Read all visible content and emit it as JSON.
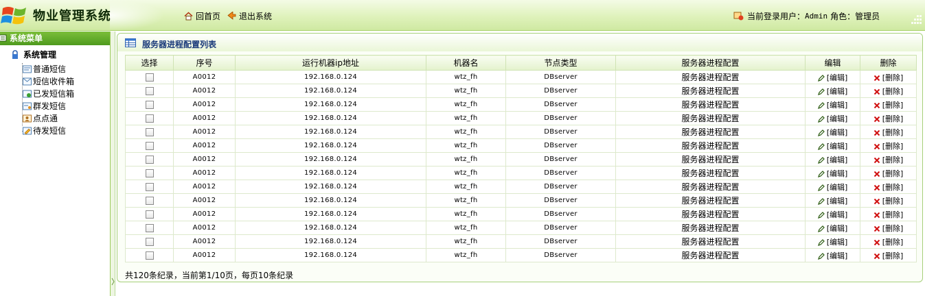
{
  "header": {
    "app_title": "物业管理系统",
    "home_label": "回首页",
    "logout_label": "退出系统",
    "user_prefix": "当前登录用户：",
    "user_name": "Admin",
    "role_prefix": "角色：",
    "role_name": "管理员"
  },
  "sidebar": {
    "title": "系统菜单",
    "group_title": "系统管理",
    "items": [
      {
        "label": "普通短信",
        "icon": "sms-icon"
      },
      {
        "label": "短信收件箱",
        "icon": "inbox-icon"
      },
      {
        "label": "已发短信箱",
        "icon": "sent-box-icon"
      },
      {
        "label": "群发短信",
        "icon": "group-sms-icon"
      },
      {
        "label": "点点通",
        "icon": "contact-icon"
      },
      {
        "label": "待发短信",
        "icon": "pending-sms-icon"
      }
    ]
  },
  "panel": {
    "title": "服务器进程配置列表",
    "columns": [
      "选择",
      "序号",
      "运行机器ip地址",
      "机器名",
      "节点类型",
      "服务器进程配置",
      "编辑",
      "删除"
    ],
    "edit_label": "[编辑]",
    "delete_label": "[删除]",
    "rows": [
      {
        "id": "A0012",
        "ip": "192.168.0.124",
        "machine": "wtz_fh",
        "node_type": "DBserver",
        "config": "服务器进程配置"
      },
      {
        "id": "A0012",
        "ip": "192.168.0.124",
        "machine": "wtz_fh",
        "node_type": "DBserver",
        "config": "服务器进程配置"
      },
      {
        "id": "A0012",
        "ip": "192.168.0.124",
        "machine": "wtz_fh",
        "node_type": "DBserver",
        "config": "服务器进程配置"
      },
      {
        "id": "A0012",
        "ip": "192.168.0.124",
        "machine": "wtz_fh",
        "node_type": "DBserver",
        "config": "服务器进程配置"
      },
      {
        "id": "A0012",
        "ip": "192.168.0.124",
        "machine": "wtz_fh",
        "node_type": "DBserver",
        "config": "服务器进程配置"
      },
      {
        "id": "A0012",
        "ip": "192.168.0.124",
        "machine": "wtz_fh",
        "node_type": "DBserver",
        "config": "服务器进程配置"
      },
      {
        "id": "A0012",
        "ip": "192.168.0.124",
        "machine": "wtz_fh",
        "node_type": "DBserver",
        "config": "服务器进程配置"
      },
      {
        "id": "A0012",
        "ip": "192.168.0.124",
        "machine": "wtz_fh",
        "node_type": "DBserver",
        "config": "服务器进程配置"
      },
      {
        "id": "A0012",
        "ip": "192.168.0.124",
        "machine": "wtz_fh",
        "node_type": "DBserver",
        "config": "服务器进程配置"
      },
      {
        "id": "A0012",
        "ip": "192.168.0.124",
        "machine": "wtz_fh",
        "node_type": "DBserver",
        "config": "服务器进程配置"
      },
      {
        "id": "A0012",
        "ip": "192.168.0.124",
        "machine": "wtz_fh",
        "node_type": "DBserver",
        "config": "服务器进程配置"
      },
      {
        "id": "A0012",
        "ip": "192.168.0.124",
        "machine": "wtz_fh",
        "node_type": "DBserver",
        "config": "服务器进程配置"
      },
      {
        "id": "A0012",
        "ip": "192.168.0.124",
        "machine": "wtz_fh",
        "node_type": "DBserver",
        "config": "服务器进程配置"
      },
      {
        "id": "A0012",
        "ip": "192.168.0.124",
        "machine": "wtz_fh",
        "node_type": "DBserver",
        "config": "服务器进程配置"
      }
    ],
    "pagination_text": "共120条纪录，当前第1/10页，每页10条纪录"
  },
  "colors": {
    "accent_green": "#4e9a1e",
    "panel_title_blue": "#1a3a7a",
    "delete_red": "#d01010"
  }
}
